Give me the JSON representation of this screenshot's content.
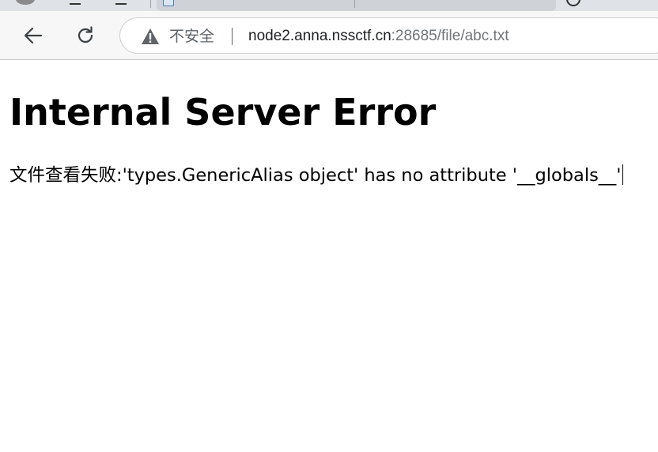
{
  "browser": {
    "security_label": "不安全",
    "url_host": "node2.anna.nssctf.cn",
    "url_rest": ":28685/file/abc.txt"
  },
  "page": {
    "heading": "Internal Server Error",
    "message": "文件查看失败:'types.GenericAlias object' has no attribute '__globals__'"
  },
  "colors": {
    "toolbar_bg": "#f7f7f7",
    "tabstrip_bg": "#dfe3e8",
    "url_host": "#202124",
    "url_rest": "#70757a"
  }
}
